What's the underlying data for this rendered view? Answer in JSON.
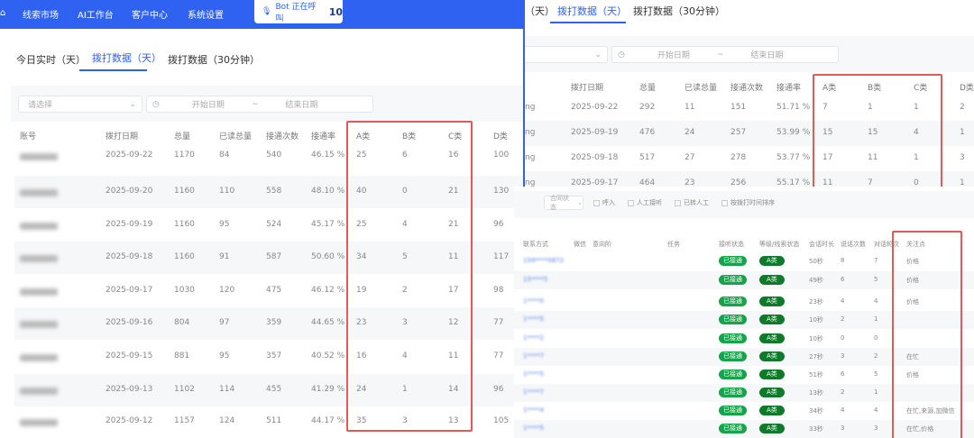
{
  "nav": {
    "items": [
      "线索市场",
      "AI工作台",
      "客户中心",
      "系统设置"
    ],
    "bot_label": "Bot 正在呼叫",
    "bot_count": "10"
  },
  "tabs": [
    "今日实时（天）",
    "拨打数据（天）",
    "拨打数据（30分钟）"
  ],
  "tabs_right": [
    "（天）",
    "拨打数据（天）",
    "拨打数据（30分钟）"
  ],
  "filter": {
    "select_placeholder": "请选择",
    "start_placeholder": "开始日期",
    "separator": "~",
    "end_placeholder": "结束日期"
  },
  "daily_table": {
    "headers": [
      "账号",
      "拨打日期",
      "总量",
      "已读总量",
      "接通次数",
      "接通率",
      "A类",
      "B类",
      "C类",
      "D类"
    ],
    "rows": [
      [
        "2025-09-22",
        "1170",
        "84",
        "540",
        "46.15 %",
        "25",
        "6",
        "16",
        "100"
      ],
      [
        "2025-09-20",
        "1160",
        "110",
        "558",
        "48.10 %",
        "40",
        "0",
        "21",
        "130"
      ],
      [
        "2025-09-19",
        "1160",
        "95",
        "524",
        "45.17 %",
        "25",
        "4",
        "21",
        "96"
      ],
      [
        "2025-09-18",
        "1160",
        "91",
        "587",
        "50.60 %",
        "34",
        "5",
        "11",
        "117"
      ],
      [
        "2025-09-17",
        "1030",
        "120",
        "475",
        "46.12 %",
        "19",
        "2",
        "17",
        "98"
      ],
      [
        "2025-09-16",
        "804",
        "97",
        "359",
        "44.65 %",
        "23",
        "3",
        "12",
        "77"
      ],
      [
        "2025-09-15",
        "881",
        "95",
        "357",
        "40.52 %",
        "16",
        "4",
        "11",
        "77"
      ],
      [
        "2025-09-13",
        "1102",
        "114",
        "455",
        "41.29 %",
        "24",
        "1",
        "14",
        "96"
      ],
      [
        "2025-09-12",
        "1157",
        "124",
        "511",
        "44.17 %",
        "35",
        "3",
        "13",
        "105"
      ]
    ]
  },
  "daily_table_right": {
    "account_fragment": "ng",
    "rows": [
      [
        "2025-09-22",
        "292",
        "11",
        "151",
        "51.71 %",
        "7",
        "1",
        "1",
        "2"
      ],
      [
        "2025-09-19",
        "476",
        "24",
        "257",
        "53.99 %",
        "15",
        "15",
        "4",
        "1"
      ],
      [
        "2025-09-18",
        "517",
        "27",
        "278",
        "53.77 %",
        "17",
        "11",
        "1",
        "3"
      ],
      [
        "2025-09-17",
        "464",
        "23",
        "256",
        "55.17 %",
        "11",
        "7",
        "0",
        "1"
      ]
    ]
  },
  "call_filters": {
    "status_select": "合同状态",
    "checkboxes": [
      "呼入",
      "人工接听",
      "已转人工",
      "按拨打时间排序"
    ]
  },
  "call_table": {
    "headers": [
      "联系方式",
      "微信",
      "意向阶",
      "任务",
      "接听状态",
      "等级/线索状态",
      "会话时长",
      "说话次数",
      "对话轮次",
      "关注点"
    ],
    "rows": [
      [
        "159****0872",
        "已接通",
        "A类",
        "50秒",
        "8",
        "7",
        "价格"
      ],
      [
        "15****5",
        "已接通",
        "A类",
        "49秒",
        "6",
        "5",
        "价格"
      ],
      [
        "1****0",
        "已接通",
        "A类",
        "23秒",
        "4",
        "4",
        "价格"
      ],
      [
        "1****5",
        "已接通",
        "A类",
        "10秒",
        "2",
        "1",
        ""
      ],
      [
        "1****2",
        "已接通",
        "A类",
        "10秒",
        "0",
        "0",
        ""
      ],
      [
        "1****7",
        "已接通",
        "A类",
        "27秒",
        "3",
        "2",
        "在忙"
      ],
      [
        "1****5",
        "已接通",
        "A类",
        "51秒",
        "6",
        "5",
        "价格"
      ],
      [
        "1****7",
        "已接通",
        "A类",
        "13秒",
        "2",
        "1",
        ""
      ],
      [
        "1****4",
        "已接通",
        "A类",
        "34秒",
        "4",
        "4",
        "在忙,来源,加微信"
      ],
      [
        "1****5",
        "已接通",
        "A类",
        "33秒",
        "3",
        "3",
        "在忙,价格"
      ]
    ]
  },
  "colors": {
    "primary": "#2f62f0",
    "highlight": "#e05a5a",
    "success": "#16a34a"
  }
}
